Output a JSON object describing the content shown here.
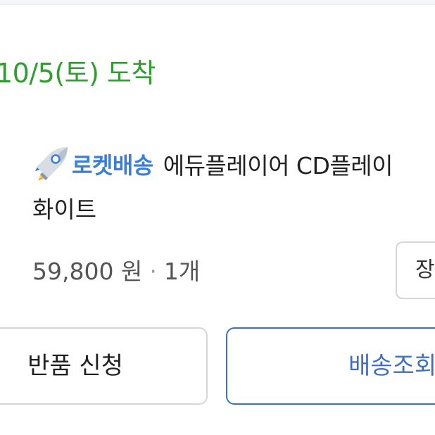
{
  "delivery": {
    "status_text": "10/5(토) 도착",
    "status_color": "#2f9e2f"
  },
  "product": {
    "badge_icon": "rocket-icon",
    "badge_label": "로켓배송",
    "badge_color": "#3a7fd6",
    "title_line1": "에듀플레이어 CD플레이",
    "title_line2": "화이트",
    "price": "59,800 원",
    "separator": "·",
    "quantity": "1개"
  },
  "actions": {
    "cart_label": "장",
    "return_label": "반품 신청",
    "tracking_label": "배송조회",
    "tracking_color": "#3e6fc0"
  }
}
